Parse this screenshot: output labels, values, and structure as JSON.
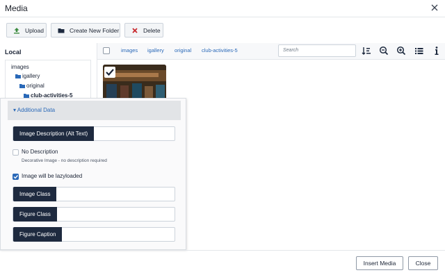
{
  "window": {
    "title": "Media"
  },
  "toolbar": {
    "upload_label": "Upload",
    "new_folder_label": "Create New Folder",
    "delete_label": "Delete"
  },
  "sidebar": {
    "title": "Local",
    "tree": [
      "images",
      "igallery",
      "original",
      "club-activities-5"
    ]
  },
  "breadcrumb": [
    "images",
    "igallery",
    "original",
    "club-activities-5"
  ],
  "search": {
    "placeholder": "Search"
  },
  "tool_icons": [
    "sort-icon",
    "zoom-out-icon",
    "zoom-in-icon",
    "list-view-icon",
    "info-icon"
  ],
  "panel": {
    "header": "Additional Data",
    "alt_text_label": "Image Description (Alt Text)",
    "alt_text_value": "",
    "no_description_label": "No Description",
    "no_description_hint": "Decorative Image - no description required",
    "no_description_checked": false,
    "lazyload_label": "Image will be lazyloaded",
    "lazyload_checked": true,
    "image_class_label": "Image Class",
    "image_class_value": "",
    "figure_class_label": "Figure Class",
    "figure_class_value": "",
    "figure_caption_label": "Figure Caption",
    "figure_caption_value": ""
  },
  "footer": {
    "insert_label": "Insert Media",
    "close_label": "Close"
  },
  "colors": {
    "accent": "#2a69b8",
    "dark_tag": "#1e2a3f",
    "upload_green": "#3b8a3e",
    "delete_red": "#c8282d"
  }
}
